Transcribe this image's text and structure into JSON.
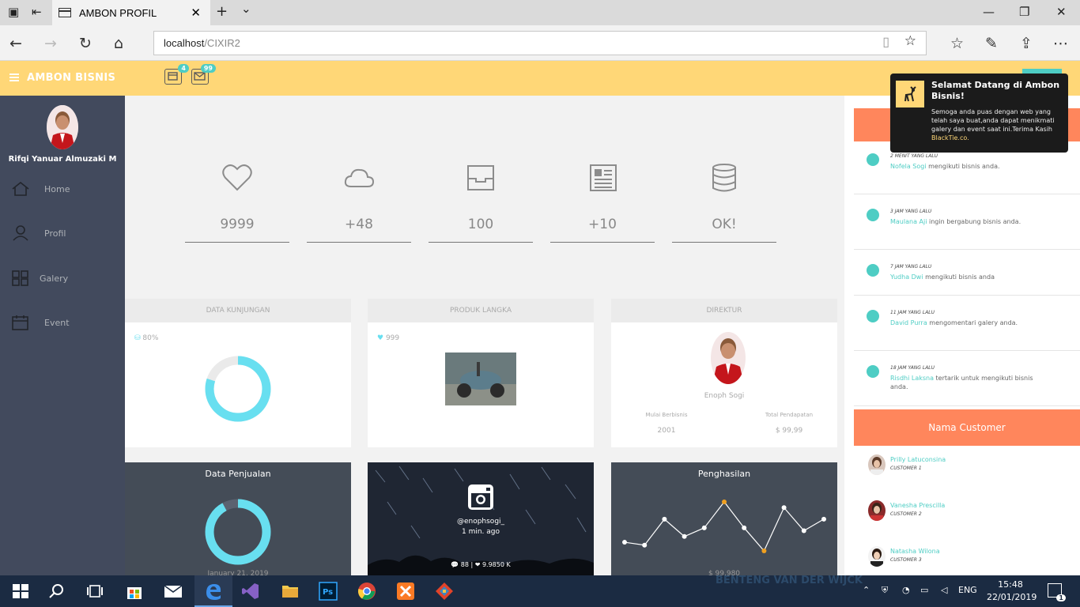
{
  "browser": {
    "tab_title": "AMBON PROFIL",
    "tab_close": "✕",
    "new_tab": "+",
    "tab_menu": "⌄",
    "minimize": "—",
    "maximize": "❐",
    "close": "✕",
    "url_host": "localhost",
    "url_path": "/CIXIR2"
  },
  "header": {
    "brand": "AMBON BISNIS",
    "notif_count": "4",
    "mail_count": "99"
  },
  "sidebar": {
    "user_name": "Rifqi Yanuar Almuzaki M",
    "items": [
      {
        "label": "Home",
        "icon": "home-icon"
      },
      {
        "label": "Profil",
        "icon": "user-icon"
      },
      {
        "label": "Galery",
        "icon": "grid-icon"
      },
      {
        "label": "Event",
        "icon": "calendar-icon"
      }
    ]
  },
  "stats": [
    {
      "value": "9999",
      "icon": "heart-icon"
    },
    {
      "value": "+48",
      "icon": "cloud-icon"
    },
    {
      "value": "100",
      "icon": "inbox-icon"
    },
    {
      "value": "+10",
      "icon": "newspaper-icon"
    },
    {
      "value": "OK!",
      "icon": "database-icon"
    }
  ],
  "panels": {
    "kunjungan": {
      "title": "DATA KUNJUNGAN",
      "percent_label": "80%",
      "percent": 80
    },
    "produk": {
      "title": "PRODUK LANGKA",
      "likes": "999"
    },
    "direktur": {
      "title": "DIREKTUR",
      "name": "Enoph Sogi",
      "col1_label": "Mulai Berbisnis",
      "col1_value": "2001",
      "col2_label": "Total Pendapatan",
      "col2_value": "$ 99,99"
    }
  },
  "dark_panels": {
    "penjualan": {
      "title": "Data Penjualan",
      "date": "January 21, 2019",
      "percent": 92
    },
    "instagram": {
      "handle": "@enophsogi_",
      "time": "1 min. ago",
      "stats": "💬 88 | ❤ 9.9850 K"
    },
    "penghasilan": {
      "title": "Penghasilan",
      "amount": "$ 99,980"
    }
  },
  "chart_data": {
    "type": "line",
    "title": "Penghasilan",
    "values": [
      5,
      4,
      13,
      7,
      10,
      19,
      10,
      2,
      17,
      9,
      13
    ],
    "highlight_indices": [
      5,
      7
    ]
  },
  "activity": [
    {
      "time": "2 MENIT YANG LALU",
      "name": "Nofela Sogi",
      "text": " mengikuti bisnis anda."
    },
    {
      "time": "3 JAM YANG LALU",
      "name": "Maulana Aji",
      "text": " ingin bergabung bisnis anda."
    },
    {
      "time": "7 JAM YANG LALU",
      "name": "Yudha Dwi",
      "text": " mengikuti bisnis anda"
    },
    {
      "time": "11 JAM YANG LALU",
      "name": "David Purra",
      "text": " mengomentari galery anda."
    },
    {
      "time": "18 JAM YANG LALU",
      "name": "Risdhi Laksna",
      "text": " tertarik untuk mengikuti bisnis anda."
    }
  ],
  "customers": {
    "title": "Nama Customer",
    "list": [
      {
        "name": "Prilly Latuconsina",
        "role": "CUSTOMER 1"
      },
      {
        "name": "Vanesha Prescilla",
        "role": "CUSTOMER 2"
      },
      {
        "name": "Natasha Wilona",
        "role": "CUSTOMER 3"
      }
    ]
  },
  "toast": {
    "title": "Selamat Datang di Ambon Bisnis!",
    "body": "Semoga anda puas dengan web yang telah saya buat,anda dapat menikmati galery dan event saat ini.Terima Kasih",
    "link": "BlackTie.co."
  },
  "taskbar": {
    "language": "ENG",
    "time": "15:48",
    "date": "22/01/2019",
    "notifications": "1",
    "wallpaper_text": "BENTENG VAN DER WIJCK"
  },
  "colors": {
    "accent": "#4ecdc4",
    "header": "#ffd777",
    "orange": "#ff865c",
    "sidebar": "#424a5d",
    "donut": "#68dff0"
  }
}
